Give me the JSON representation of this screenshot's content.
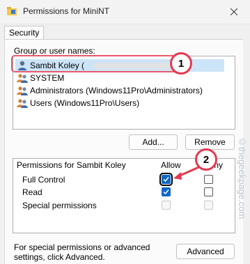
{
  "window": {
    "title": "Permissions for MiniNT"
  },
  "tabs": [
    {
      "label": "Security",
      "active": true
    }
  ],
  "groups": {
    "label": "Group or user names:",
    "users": [
      {
        "name": "Sambit Koley (",
        "icon": "user-icon",
        "selected": true
      },
      {
        "name": "SYSTEM",
        "icon": "users-group-icon",
        "selected": false
      },
      {
        "name": "Administrators (Windows11Pro\\Administrators)",
        "icon": "users-group-icon",
        "selected": false
      },
      {
        "name": "Users (Windows11Pro\\Users)",
        "icon": "users-group-icon",
        "selected": false
      }
    ],
    "add_label": "Add...",
    "remove_label": "Remove"
  },
  "permissions": {
    "label": "Permissions for Sambit Koley",
    "allow_label": "Allow",
    "deny_label": "Deny",
    "rows": [
      {
        "name": "Full Control",
        "allow": true,
        "deny": false,
        "enabled": true
      },
      {
        "name": "Read",
        "allow": true,
        "deny": false,
        "enabled": true
      },
      {
        "name": "Special permissions",
        "allow": false,
        "deny": false,
        "enabled": false
      }
    ]
  },
  "footer": {
    "text": "For special permissions or advanced settings, click Advanced.",
    "advanced_label": "Advanced"
  },
  "annotations": {
    "step1": "1",
    "step2": "2",
    "color": "#e3394f"
  },
  "watermark": "©thegeekpage.com"
}
